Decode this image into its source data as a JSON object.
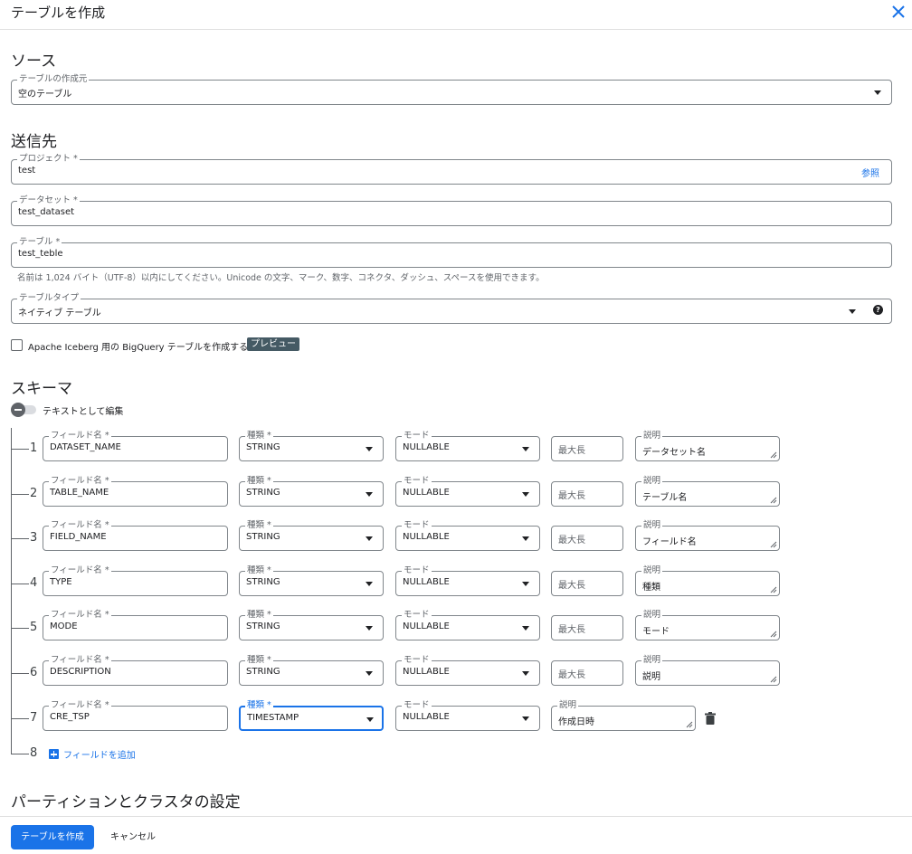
{
  "header": {
    "title": "テーブルを作成"
  },
  "source": {
    "section_title": "ソース",
    "create_from": {
      "label": "テーブルの作成元",
      "value": "空のテーブル"
    }
  },
  "destination": {
    "section_title": "送信先",
    "project": {
      "label": "プロジェクト *",
      "value": "test",
      "browse_label": "参照"
    },
    "dataset": {
      "label": "データセット *",
      "value": "test_dataset"
    },
    "table": {
      "label": "テーブル *",
      "value": "test_teble"
    },
    "table_hint": "名前は 1,024 バイト（UTF-8）以内にしてください。Unicode の文字、マーク、数字、コネクタ、ダッシュ、スペースを使用できます。",
    "table_type": {
      "label": "テーブルタイプ",
      "value": "ネイティブ テーブル",
      "help": "?"
    },
    "iceberg_checkbox_label": "Apache Iceberg 用の BigQuery テーブルを作成する",
    "preview_badge": "プレビュー"
  },
  "schema": {
    "section_title": "スキーマ",
    "edit_as_text_label": "テキストとして編集",
    "labels": {
      "field_name": "フィールド名 *",
      "type": "種類 *",
      "mode": "モード",
      "max_length": "最大長",
      "description": "説明"
    },
    "rows": [
      {
        "num": "1",
        "name": "DATASET_NAME",
        "type": "STRING",
        "mode": "NULLABLE",
        "description": "データセット名"
      },
      {
        "num": "2",
        "name": "TABLE_NAME",
        "type": "STRING",
        "mode": "NULLABLE",
        "description": "テーブル名"
      },
      {
        "num": "3",
        "name": "FIELD_NAME",
        "type": "STRING",
        "mode": "NULLABLE",
        "description": "フィールド名"
      },
      {
        "num": "4",
        "name": "TYPE",
        "type": "STRING",
        "mode": "NULLABLE",
        "description": "種類"
      },
      {
        "num": "5",
        "name": "MODE",
        "type": "STRING",
        "mode": "NULLABLE",
        "description": "モード"
      },
      {
        "num": "6",
        "name": "DESCRIPTION",
        "type": "STRING",
        "mode": "NULLABLE",
        "description": "説明"
      },
      {
        "num": "7",
        "name": "CRE_TSP",
        "type": "TIMESTAMP",
        "mode": "NULLABLE",
        "description": "作成日時"
      }
    ],
    "add_row_num": "8",
    "add_field_label": "フィールドを追加"
  },
  "partition": {
    "section_title": "パーティションとクラスタの設定"
  },
  "footer": {
    "create_button": "テーブルを作成",
    "cancel_button": "キャンセル"
  },
  "colors": {
    "accent": "#1a73e8",
    "badge": "#455a64"
  }
}
